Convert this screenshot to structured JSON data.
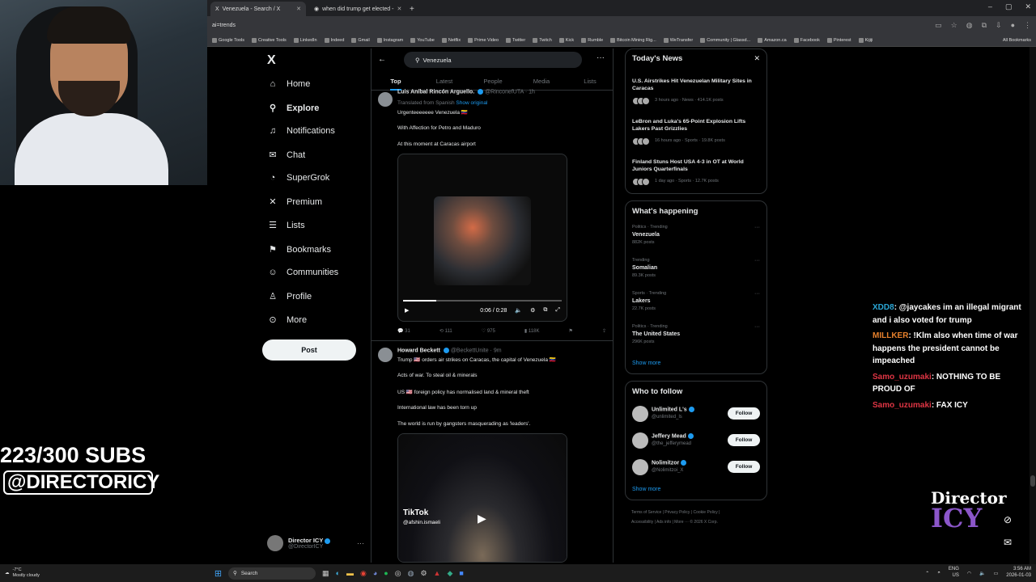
{
  "browser": {
    "tabs": [
      {
        "title": "Venezuela - Search / X",
        "active": true
      },
      {
        "title": "when did trump get elected - ",
        "active": false
      }
    ],
    "address_text": "ai=trends",
    "bookmarks": [
      "Google Tools",
      "Creative Tools",
      "LinkedIn",
      "Indeed",
      "Gmail",
      "Instagram",
      "YouTube",
      "Netflix",
      "Prime Video",
      "Twitter",
      "Twitch",
      "Kick",
      "Rumble",
      "Bitcoin Mining Rig...",
      "WeTransfer",
      "Community | Glassd...",
      "Amazon.ca",
      "Facebook",
      "Pinterest",
      "Kijiji"
    ],
    "all_bookmarks": "All Bookmarks"
  },
  "overlay": {
    "subs": "223/300 SUBS",
    "handle": "@DIRECTORICY",
    "logo_line1": "Director",
    "logo_line2": "ICY"
  },
  "sidebar": {
    "logo": "X",
    "items": [
      {
        "label": "Home",
        "icon": "home-icon",
        "glyph": "⌂"
      },
      {
        "label": "Explore",
        "icon": "search-icon",
        "glyph": "⚲",
        "active": true
      },
      {
        "label": "Notifications",
        "icon": "bell-icon",
        "glyph": "♫"
      },
      {
        "label": "Chat",
        "icon": "mail-icon",
        "glyph": "✉"
      },
      {
        "label": "SuperGrok",
        "icon": "grok-icon",
        "glyph": "◔"
      },
      {
        "label": "Premium",
        "icon": "x-icon",
        "glyph": "✕"
      },
      {
        "label": "Lists",
        "icon": "list-icon",
        "glyph": "☰"
      },
      {
        "label": "Bookmarks",
        "icon": "bookmark-icon",
        "glyph": "⚑"
      },
      {
        "label": "Communities",
        "icon": "people-icon",
        "glyph": "☺"
      },
      {
        "label": "Profile",
        "icon": "person-icon",
        "glyph": "♙"
      },
      {
        "label": "More",
        "icon": "more-icon",
        "glyph": "⊙"
      }
    ],
    "post_label": "Post",
    "account_name": "Director ICY",
    "account_handle": "@DirectorICY"
  },
  "search": {
    "query": "Venezuela",
    "tabs": [
      "Top",
      "Latest",
      "People",
      "Media",
      "Lists"
    ]
  },
  "tweets": [
    {
      "name": "Luis Aníbal Rincón Arguello.",
      "handle": "@RinconefUTA · 1h",
      "translated": "Translated from Spanish",
      "show_original": "Show original",
      "lines": [
        "Urgenteeeeeee Venezuela 🇻🇪",
        "With Affection for Petro and Maduro",
        "At this moment at Caracas airport"
      ],
      "video_time": "0:06 / 0:28",
      "video_progress": 0.21,
      "stats": {
        "replies": "31",
        "reposts": "111",
        "likes": "975",
        "views": "118K"
      }
    },
    {
      "name": "Howard Beckett",
      "handle": "@BeckettUnite · 9m",
      "lines": [
        "Trump 🇺🇸 orders air strikes on Caracas, the capital of Venezuela 🇻🇪",
        "Acts of war. To steal oil & minerals",
        "US 🇺🇸 foreign policy has normalised land & mineral theft",
        "International law has been torn up",
        "The world is run by gangsters masquerading as 'leaders'."
      ],
      "tiktok": "TikTok",
      "tiktok_handle": "@afshin.ismaeli"
    }
  ],
  "news": {
    "title": "Today's News",
    "items": [
      {
        "headline": "U.S. Airstrikes Hit Venezuelan Military Sites in Caracas",
        "meta": "3 hours ago · News · 414.1K posts"
      },
      {
        "headline": "LeBron and Luka's 65-Point Explosion Lifts Lakers Past Grizzlies",
        "meta": "16 hours ago · Sports · 19.8K posts"
      },
      {
        "headline": "Finland Stuns Host USA 4-3 in OT at World Juniors Quarterfinals",
        "meta": "1 day ago · Sports · 12.7K posts"
      }
    ]
  },
  "happening": {
    "title": "What's happening",
    "items": [
      {
        "category": "Politics · Trending",
        "name": "Venezuela",
        "posts": "882K posts"
      },
      {
        "category": "Trending",
        "name": "Somalian",
        "posts": "89.3K posts"
      },
      {
        "category": "Sports · Trending",
        "name": "Lakers",
        "posts": "22.7K posts"
      },
      {
        "category": "Politics · Trending",
        "name": "The United States",
        "posts": "296K posts"
      }
    ],
    "show_more": "Show more"
  },
  "who_to_follow": {
    "title": "Who to follow",
    "items": [
      {
        "name": "Unlimited L's",
        "handle": "@unlimited_ls"
      },
      {
        "name": "Jeffery Mead",
        "handle": "@the_jefferymead"
      },
      {
        "name": "Nolimitzor",
        "handle": "@Nolimitzoi_X"
      }
    ],
    "follow_label": "Follow",
    "show_more": "Show more"
  },
  "footer": {
    "line1": "Terms of Service  |  Privacy Policy  |  Cookie Policy  |",
    "line2": "Accessibility  |  Ads info  |  More ···  © 2026 X Corp."
  },
  "chat": [
    {
      "user": "XDD8",
      "text": ": @jaycakes im an illegal migrant and i also voted for trump"
    },
    {
      "user": "MILLKER",
      "text": ": !Klm also when time of war happens the president cannot be impeached"
    },
    {
      "user": "Samo_uzumaki",
      "text": ": NOTHING TO BE PROUD OF"
    },
    {
      "user": "Samo_uzumaki",
      "text": ": FAX ICY"
    }
  ],
  "taskbar": {
    "temp": "-7°C",
    "weather": "Mostly cloudy",
    "search": "Search",
    "lang": "ENG",
    "region": "US",
    "time": "3:56 AM",
    "date": "2026-01-03"
  }
}
